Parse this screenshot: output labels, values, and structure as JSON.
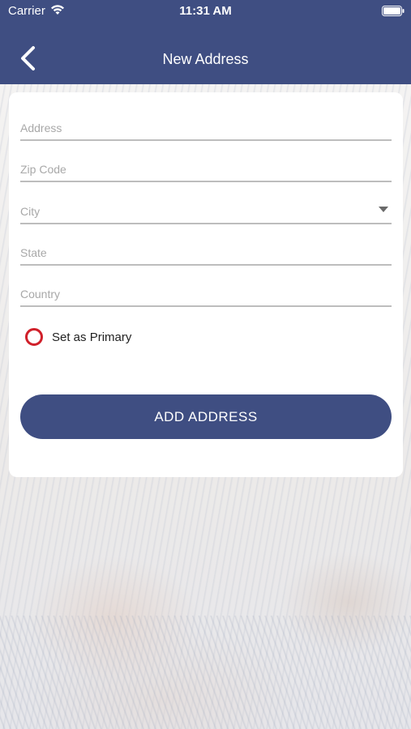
{
  "status_bar": {
    "carrier": "Carrier",
    "time": "11:31 AM",
    "wifi_icon": "wifi-icon",
    "battery_icon": "battery-icon"
  },
  "header": {
    "title": "New Address",
    "back_icon": "chevron-left-icon"
  },
  "form": {
    "address_placeholder": "Address",
    "address_value": "",
    "zip_placeholder": "Zip Code",
    "zip_value": "",
    "city_placeholder": "City",
    "city_value": "",
    "state_placeholder": "State",
    "state_value": "",
    "country_placeholder": "Country",
    "country_value": "",
    "primary_label": "Set as Primary",
    "primary_checked": false,
    "submit_label": "ADD ADDRESS"
  },
  "colors": {
    "brand": "#3f4e82",
    "radio": "#d0202a",
    "underline": "#bdbdbd"
  }
}
